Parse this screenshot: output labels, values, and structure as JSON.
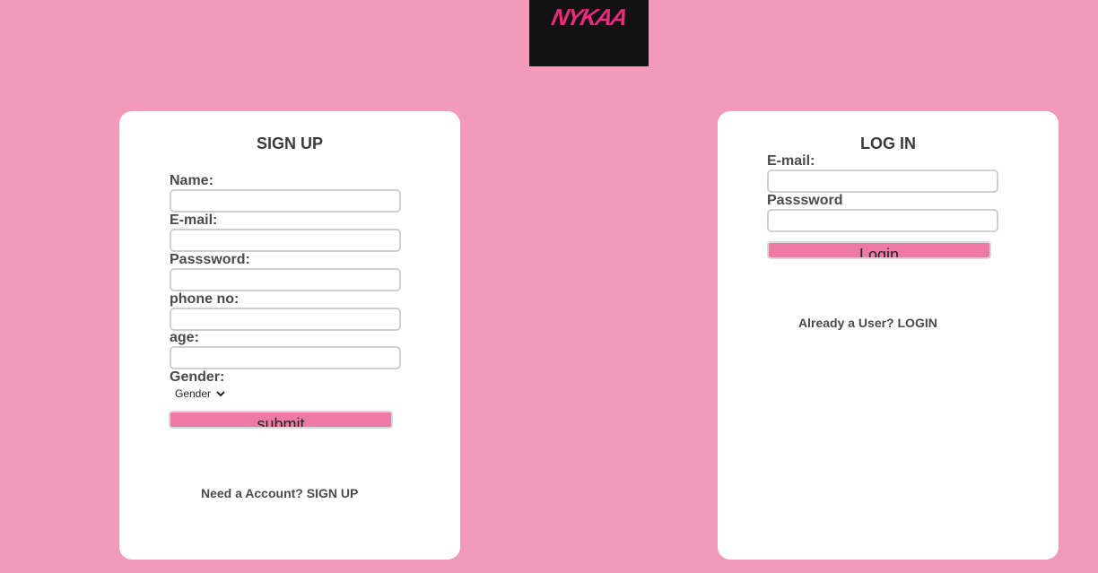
{
  "logo": {
    "text": "NYKAA"
  },
  "signup": {
    "title": "SIGN UP",
    "fields": [
      {
        "label": "Name:",
        "value": "",
        "placeholder": ""
      },
      {
        "label": "E-mail:",
        "value": "",
        "placeholder": ""
      },
      {
        "label": "Passsword:",
        "value": "",
        "placeholder": ""
      },
      {
        "label": "phone no:",
        "value": "",
        "placeholder": ""
      },
      {
        "label": "age:",
        "value": "",
        "placeholder": ""
      }
    ],
    "gender_label": "Gender:",
    "gender_selected": "Gender",
    "submit_label": "submit",
    "footer_text": "Need a Account?",
    "footer_link": "SIGN UP"
  },
  "login": {
    "title": "LOG IN",
    "fields": [
      {
        "label": "E-mail:",
        "value": "",
        "placeholder": ""
      },
      {
        "label": "Passsword",
        "value": "",
        "placeholder": ""
      }
    ],
    "login_label": "Login",
    "footer_text": "Already a User?",
    "footer_link": "LOGIN"
  },
  "colors": {
    "background": "#f19ab9",
    "logo_bg": "#121212",
    "brand_pink": "#ee2a7b",
    "button_pink": "#ef79a5"
  }
}
